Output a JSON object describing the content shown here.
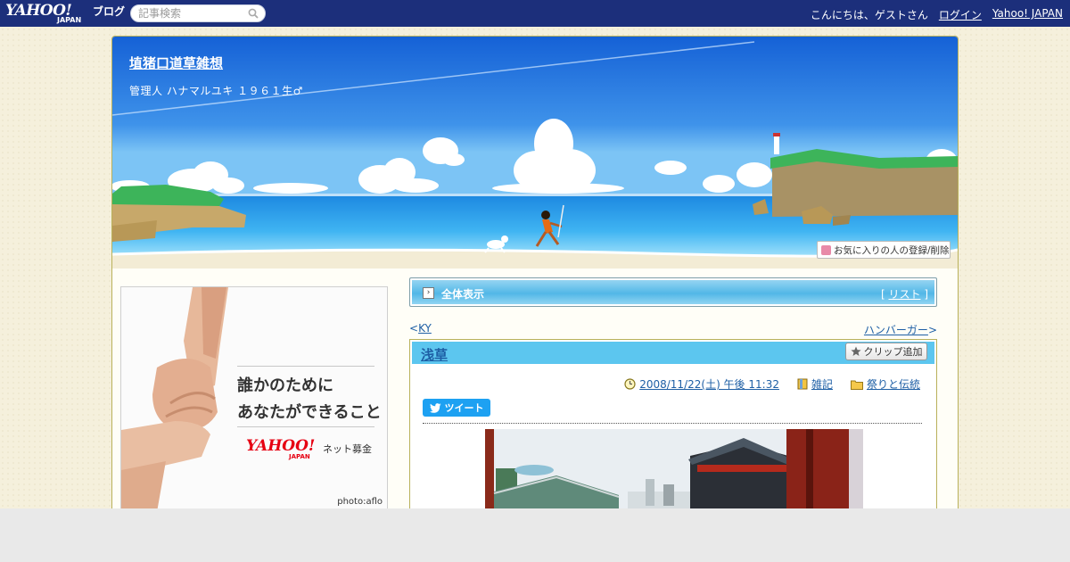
{
  "header": {
    "logo_text": "YAHOO!",
    "logo_sub": "JAPAN",
    "logo_blog": "ブログ",
    "search_placeholder": "記事検索",
    "greeting": "こんにちは、ゲストさん",
    "login_label": "ログイン",
    "yahoo_japan_label": "Yahoo! JAPAN"
  },
  "blog": {
    "title": "埴猪口道草雑想",
    "subtitle": "管理人 ハナマルユキ １９６１生♂",
    "favorite_button": "お気に入りの人の登録/削除"
  },
  "ad": {
    "line1": "誰かのために",
    "line2": "あなたができること",
    "brand": "YAHOO!",
    "brand_sub": "JAPAN",
    "service": "ネット募金",
    "credit": "photo:aflo"
  },
  "nav": {
    "all_label": "全体表示",
    "list_open": "[",
    "list_label": "リスト",
    "list_close": "]",
    "prev_marker": "<",
    "prev_label": "KY",
    "next_label": "ハンバーガー",
    "next_marker": ">"
  },
  "article": {
    "title": "浅草",
    "clip_label": "クリップ追加",
    "datetime": "2008/11/22(土) 午後 11:32",
    "category": "雑記",
    "folder": "祭りと伝統",
    "tweet_label": "ツイート"
  },
  "colors": {
    "topbar": "#1c2f7b",
    "link": "#1e5fa5",
    "article_head": "#5cc6ef",
    "border": "#b9b15a"
  }
}
